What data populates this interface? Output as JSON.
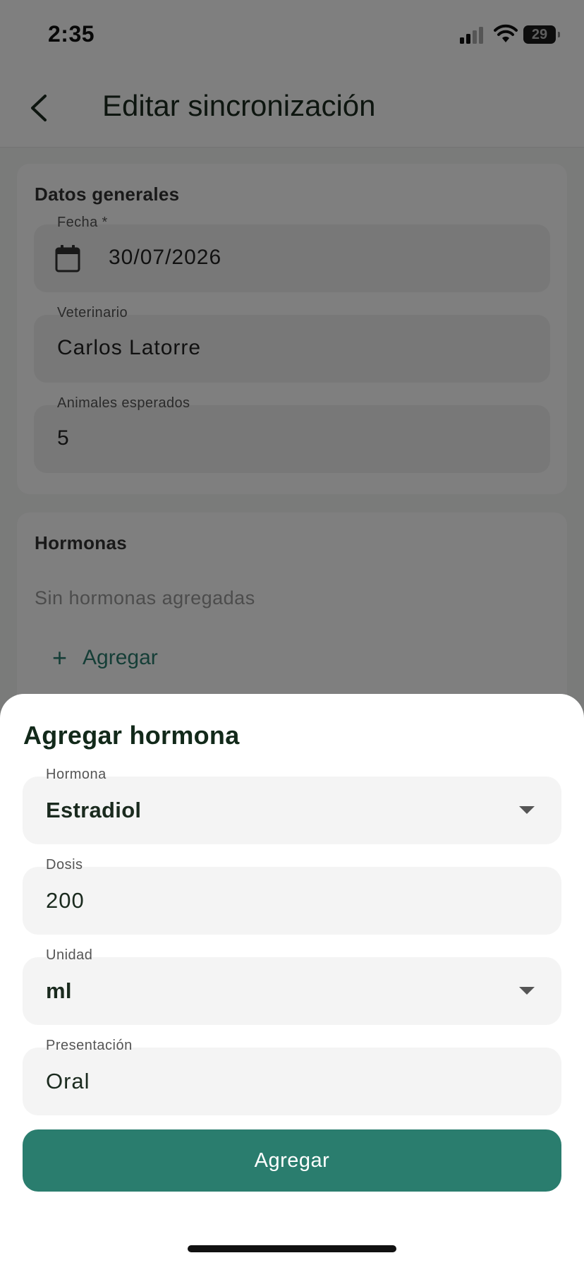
{
  "status_bar": {
    "time": "2:35",
    "battery": "29"
  },
  "app_bar": {
    "title": "Editar sincronización"
  },
  "general": {
    "title": "Datos generales",
    "date": {
      "label": "Fecha *",
      "value": "30/07/2026"
    },
    "vet": {
      "label": "Veterinario",
      "value": "Carlos Latorre"
    },
    "animals": {
      "label": "Animales esperados",
      "value": "5"
    }
  },
  "hormones": {
    "title": "Hormonas",
    "empty": "Sin hormonas agregadas",
    "add_label": "Agregar"
  },
  "sheet": {
    "title": "Agregar hormona",
    "hormone": {
      "label": "Hormona",
      "value": "Estradiol"
    },
    "dose": {
      "label": "Dosis",
      "value": "200"
    },
    "unit": {
      "label": "Unidad",
      "value": "ml"
    },
    "presentation": {
      "label": "Presentación",
      "value": "Oral"
    },
    "submit_label": "Agregar"
  },
  "colors": {
    "accent": "#2a7d6e",
    "overlay": "rgba(0,0,0,0.5)",
    "field_bg": "#f4f4f4"
  }
}
